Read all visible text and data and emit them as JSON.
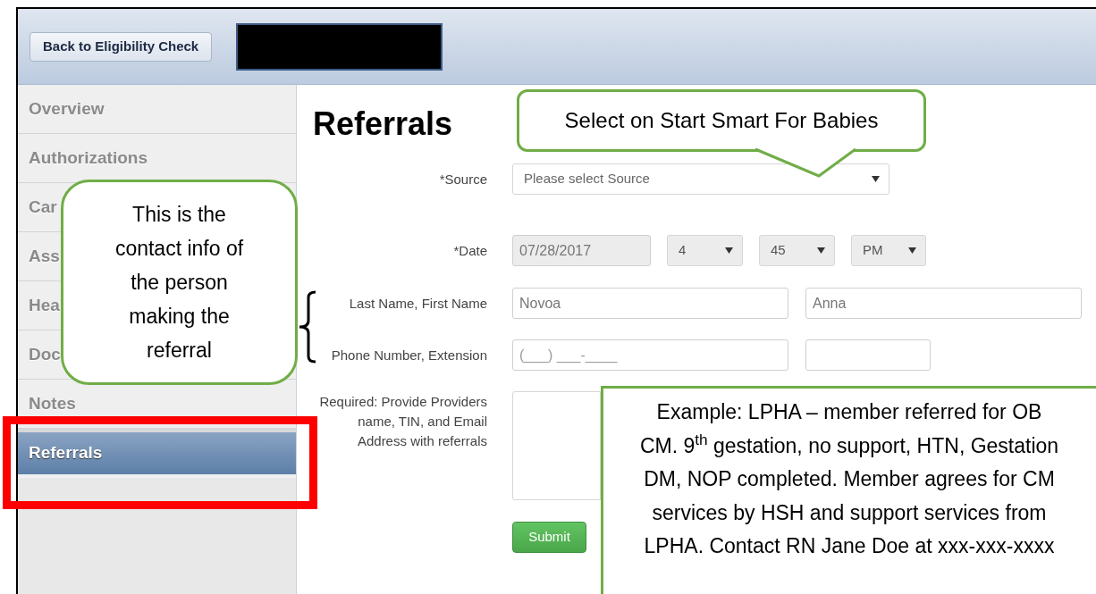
{
  "header": {
    "back_button": "Back to Eligibility Check",
    "redacted": true
  },
  "sidebar": {
    "items": [
      {
        "label": "Overview",
        "selected": false
      },
      {
        "label": "Authorizations",
        "selected": false
      },
      {
        "label": "Car",
        "selected": false
      },
      {
        "label": "Ass",
        "selected": false
      },
      {
        "label": "Hea",
        "selected": false
      },
      {
        "label": "Doc",
        "selected": false
      },
      {
        "label": "Notes",
        "selected": false
      },
      {
        "label": "Referrals",
        "selected": true
      }
    ]
  },
  "page_title": "Referrals",
  "form": {
    "rows": [
      {
        "label": "*Source",
        "controls": [
          {
            "kind": "select",
            "placeholder": "Please select Source",
            "disabled": false
          }
        ]
      },
      {
        "label": "*Date",
        "controls": [
          {
            "kind": "input",
            "value": "07/28/2017",
            "disabled": true
          },
          {
            "kind": "select",
            "value": "4",
            "disabled": true
          },
          {
            "kind": "select",
            "value": "45",
            "disabled": true
          },
          {
            "kind": "select",
            "value": "PM",
            "disabled": true
          }
        ]
      },
      {
        "label": "Last Name, First Name",
        "controls": [
          {
            "kind": "input",
            "value": "Novoa",
            "disabled": false
          },
          {
            "kind": "input",
            "value": "Anna",
            "disabled": false
          }
        ]
      },
      {
        "label": "Phone Number, Extension",
        "controls": [
          {
            "kind": "input",
            "placeholder": "(___) ___-____",
            "disabled": false
          },
          {
            "kind": "input",
            "disabled": false
          }
        ]
      },
      {
        "label": "Required: Provide Providers name, TIN, and Email Address with referrals",
        "controls": [
          {
            "kind": "textarea",
            "disabled": false
          }
        ]
      }
    ],
    "submit": "Submit"
  },
  "annotations": [
    {
      "kind": "top",
      "text": "Select on Start Smart For Babies"
    },
    {
      "kind": "left",
      "text": "This is the contact info of the person making the referral"
    },
    {
      "kind": "bottom",
      "text": "Example: LPHA – member referred for OB CM. 9$^{th}$ gestation, no support, HTN, Gestation DM, NOP completed. Member agrees for CM services by HSH and support services from LPHA.  Contact RN Jane Doe at xxx-xxx-xxxx"
    }
  ]
}
